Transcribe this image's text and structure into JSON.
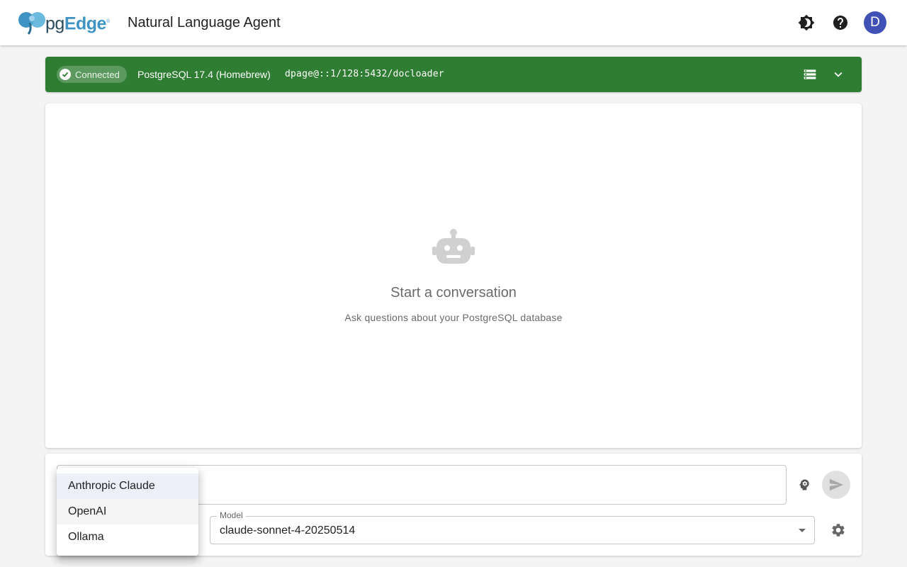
{
  "header": {
    "logo": {
      "pg": "pg",
      "edge": "Edge",
      "mark": "®"
    },
    "title": "Natural Language Agent",
    "icons": {
      "theme": "brightness-icon",
      "help": "help-icon"
    },
    "avatar_initial": "D",
    "avatar_color": "#3f51b5"
  },
  "connection": {
    "status": "Connected",
    "server": "PostgreSQL 17.4 (Homebrew)",
    "dsn": "dpage@::1/128:5432/docloader",
    "bar_color": "#2e7d32",
    "icons": {
      "databases": "database-list-icon",
      "expand": "chevron-down-icon"
    }
  },
  "chat": {
    "empty_icon": "robot-icon",
    "empty_title": "Start a conversation",
    "empty_subtitle": "Ask questions about your PostgreSQL database"
  },
  "composer": {
    "message_value": "",
    "message_placeholder": "",
    "model_label": "Model",
    "model_value": "claude-sonnet-4-20250514",
    "icons": {
      "brain": "brain-icon",
      "send": "send-icon",
      "settings": "gear-icon"
    }
  },
  "provider_menu": {
    "items": [
      {
        "label": "Anthropic Claude",
        "state": "selected"
      },
      {
        "label": "OpenAI",
        "state": "hover"
      },
      {
        "label": "Ollama",
        "state": ""
      }
    ]
  }
}
